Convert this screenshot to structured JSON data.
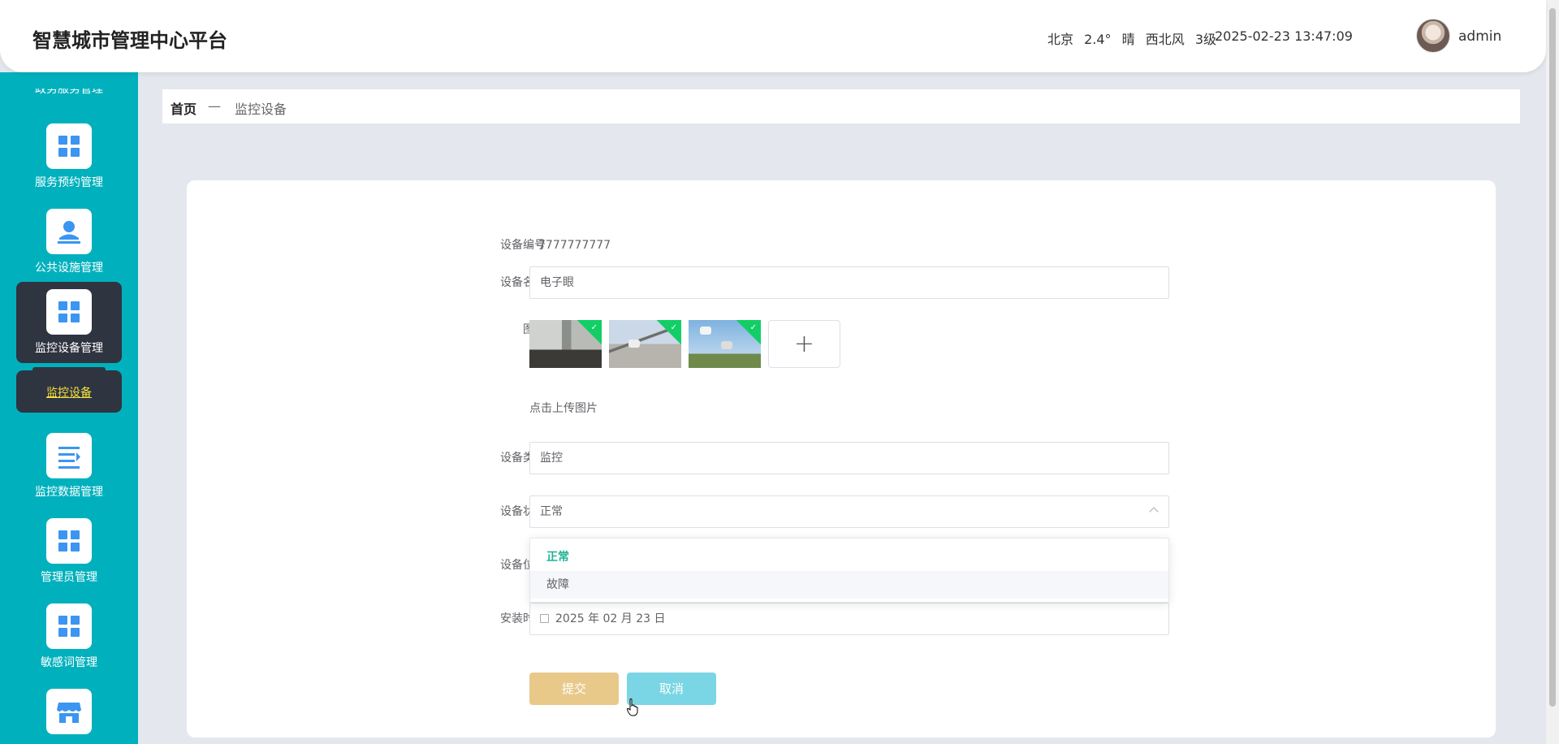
{
  "header": {
    "title": "智慧城市管理中心平台",
    "weather": {
      "city": "北京",
      "temperature": "2.4°",
      "condition": "晴",
      "wind": "西北风",
      "level": "3级"
    },
    "datetime": "2025-02-23 13:47:09",
    "username": "admin"
  },
  "sidebar": {
    "partial_label": "政务服务管理",
    "items": [
      {
        "label": "服务预约管理",
        "icon": "grid-icon"
      },
      {
        "label": "公共设施管理",
        "icon": "person-icon"
      },
      {
        "label": "监控设备管理",
        "icon": "grid-icon",
        "active": true
      },
      {
        "label": "监控数据管理",
        "icon": "list-icon"
      },
      {
        "label": "管理员管理",
        "icon": "grid-icon"
      },
      {
        "label": "敏感词管理",
        "icon": "grid-icon"
      },
      {
        "label": "",
        "icon": "store-icon"
      }
    ],
    "submenu": {
      "label": "监控设备"
    }
  },
  "breadcrumb": {
    "home": "首页",
    "separator": "—",
    "current": "监控设备"
  },
  "form": {
    "device_no": {
      "label": "设备编号",
      "value": "7777777777"
    },
    "device_name": {
      "label": "设备名称",
      "value": "电子眼"
    },
    "images": {
      "label": "图片",
      "hint": "点击上传图片",
      "add_symbol": "+"
    },
    "device_type": {
      "label": "设备类型",
      "value": "监控"
    },
    "device_status": {
      "label": "设备状态",
      "value": "正常",
      "options": [
        "正常",
        "故障"
      ]
    },
    "device_location": {
      "label": "设备位置",
      "value": ""
    },
    "install_time": {
      "label": "安装时间",
      "value": "2025 年 02 月 23 日"
    },
    "submit_label": "提交",
    "cancel_label": "取消"
  },
  "colors": {
    "sidebar_bg": "#00b1bd",
    "active_bg": "#2f3441",
    "submenu_text": "#f5e23b",
    "selected_option": "#1fb395",
    "submit_btn": "#e8c98a",
    "cancel_btn": "#7ad6e4",
    "icon_blue": "#3c95f0"
  }
}
